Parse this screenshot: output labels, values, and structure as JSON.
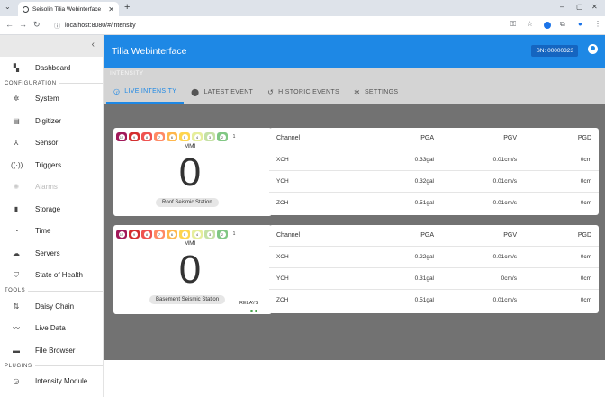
{
  "browser": {
    "tab_title": "Seisolin Tilia Webinterface",
    "url": "localhost:8080/#/intensity"
  },
  "sidebar": {
    "dashboard": "Dashboard",
    "sections": {
      "configuration": "CONFIGURATION",
      "tools": "TOOLS",
      "plugins": "PLUGINS"
    },
    "config_items": [
      {
        "label": "System",
        "icon": "gear-icon"
      },
      {
        "label": "Digitizer",
        "icon": "digitizer-icon"
      },
      {
        "label": "Sensor",
        "icon": "sensor-icon"
      },
      {
        "label": "Triggers",
        "icon": "wave-icon"
      },
      {
        "label": "Alarms",
        "icon": "alarm-icon"
      },
      {
        "label": "Storage",
        "icon": "storage-icon"
      },
      {
        "label": "Time",
        "icon": "clock-icon"
      },
      {
        "label": "Servers",
        "icon": "cloud-icon"
      },
      {
        "label": "State of Health",
        "icon": "shield-icon"
      }
    ],
    "tools_items": [
      {
        "label": "Daisy Chain",
        "icon": "daisy-chain-icon"
      },
      {
        "label": "Live Data",
        "icon": "trend-icon"
      },
      {
        "label": "File Browser",
        "icon": "folder-icon"
      }
    ],
    "plugins_items": [
      {
        "label": "Intensity Module",
        "icon": "gauge-icon"
      }
    ]
  },
  "header": {
    "title": "Tilia Webinterface",
    "serial": "SN: 00000323",
    "subtitle": "INTENSITY"
  },
  "tabs": [
    {
      "label": "LIVE INTENSITY",
      "icon": "gauge-icon",
      "active": true
    },
    {
      "label": "LATEST EVENT",
      "icon": "alert-icon",
      "active": false
    },
    {
      "label": "HISTORIC EVENTS",
      "icon": "history-icon",
      "active": false
    },
    {
      "label": "SETTINGS",
      "icon": "gear-icon",
      "active": false
    }
  ],
  "mmi_scale": {
    "levels": [
      "12",
      "9",
      "8",
      "7",
      "6",
      "5",
      "4",
      "3",
      "2",
      "1"
    ],
    "colors": [
      "#a1195a",
      "#d32f2f",
      "#ef5350",
      "#ff8a65",
      "#ffb74d",
      "#ffd54f",
      "#e6ee9c",
      "#c5e1a5",
      "#81c784",
      "#ffffff"
    ]
  },
  "stations": [
    {
      "mmi_label": "MMI",
      "mmi_value": "0",
      "name": "Roof Seismic Station",
      "table": {
        "headers": [
          "Channel",
          "PGA",
          "PGV",
          "PGD"
        ],
        "rows": [
          [
            "XCH",
            "0.33gal",
            "0.01cm/s",
            "0cm"
          ],
          [
            "YCH",
            "0.32gal",
            "0.01cm/s",
            "0cm"
          ],
          [
            "ZCH",
            "0.51gal",
            "0.01cm/s",
            "0cm"
          ]
        ]
      }
    },
    {
      "mmi_label": "MMI",
      "mmi_value": "0",
      "name": "Basement Seismic Station",
      "relays_label": "RELAYS",
      "table": {
        "headers": [
          "Channel",
          "PGA",
          "PGV",
          "PGD"
        ],
        "rows": [
          [
            "XCH",
            "0.22gal",
            "0.01cm/s",
            "0cm"
          ],
          [
            "YCH",
            "0.31gal",
            "0cm/s",
            "0cm"
          ],
          [
            "ZCH",
            "0.51gal",
            "0.01cm/s",
            "0cm"
          ]
        ]
      }
    }
  ]
}
